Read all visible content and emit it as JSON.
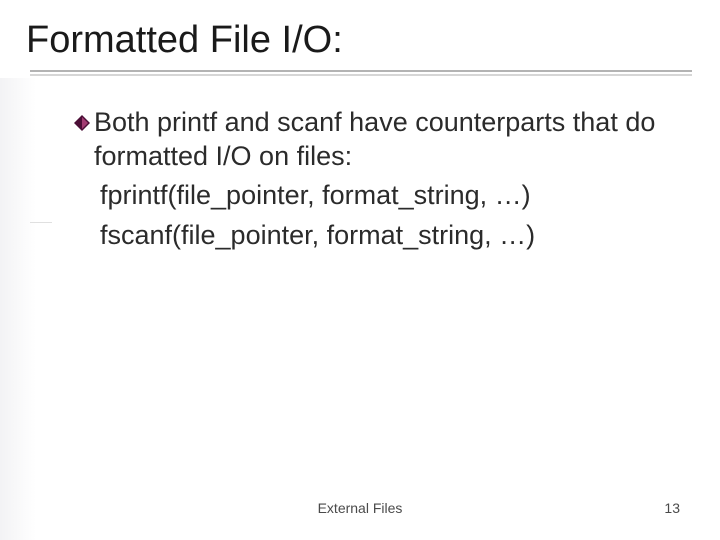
{
  "title": "Formatted File I/O:",
  "bullet": {
    "lead": " Both printf and scanf have counterparts that do formatted I/O on files:",
    "line1": "fprintf(file_pointer, format_string, …)",
    "line2": "fscanf(file_pointer, format_string, …)"
  },
  "footer": "External Files",
  "page_number": "13",
  "colors": {
    "bullet_fill": "#4b0e36",
    "bullet_glow": "#b3437d"
  }
}
